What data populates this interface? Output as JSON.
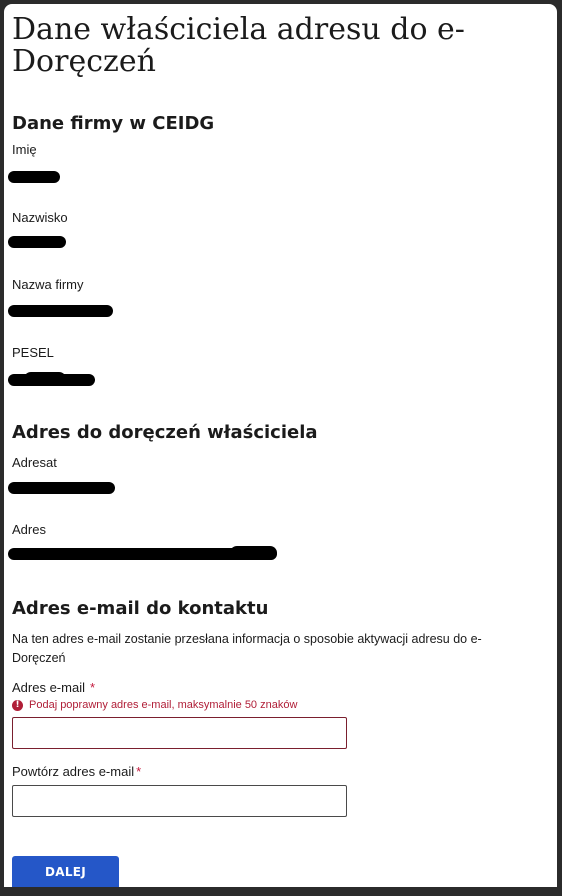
{
  "page": {
    "title": "Dane właściciela adresu do e-Doręczeń"
  },
  "ceidg_section": {
    "title": "Dane firmy w CEIDG",
    "fields": [
      {
        "label": "Imię",
        "value_redacted": true
      },
      {
        "label": "Nazwisko",
        "value_redacted": true
      },
      {
        "label": "Nazwa firmy",
        "value_redacted": true
      },
      {
        "label": "PESEL",
        "value_redacted": true
      }
    ]
  },
  "address_section": {
    "title": "Adres do doręczeń właściciela",
    "fields": [
      {
        "label": "Adresat",
        "value_redacted": true
      },
      {
        "label": "Adres",
        "value_redacted": true
      }
    ]
  },
  "email_section": {
    "title": "Adres e-mail do kontaktu",
    "description": "Na ten adres e-mail zostanie przesłana informacja o sposobie aktywacji adresu do e-Doręczeń",
    "email_label": "Adres e-mail",
    "required_mark": "*",
    "error_icon": "exclamation-circle-icon",
    "error_message": "Podaj poprawny adres e-mail, maksymalnie 50 znaków",
    "email_value": "",
    "repeat_label": "Powtórz adres e-mail",
    "repeat_value": ""
  },
  "actions": {
    "next_label": "DALEJ"
  },
  "colors": {
    "primary_button": "#2557c8",
    "error": "#b01e37",
    "required": "#c4193d",
    "background": "#2b2b2b"
  }
}
